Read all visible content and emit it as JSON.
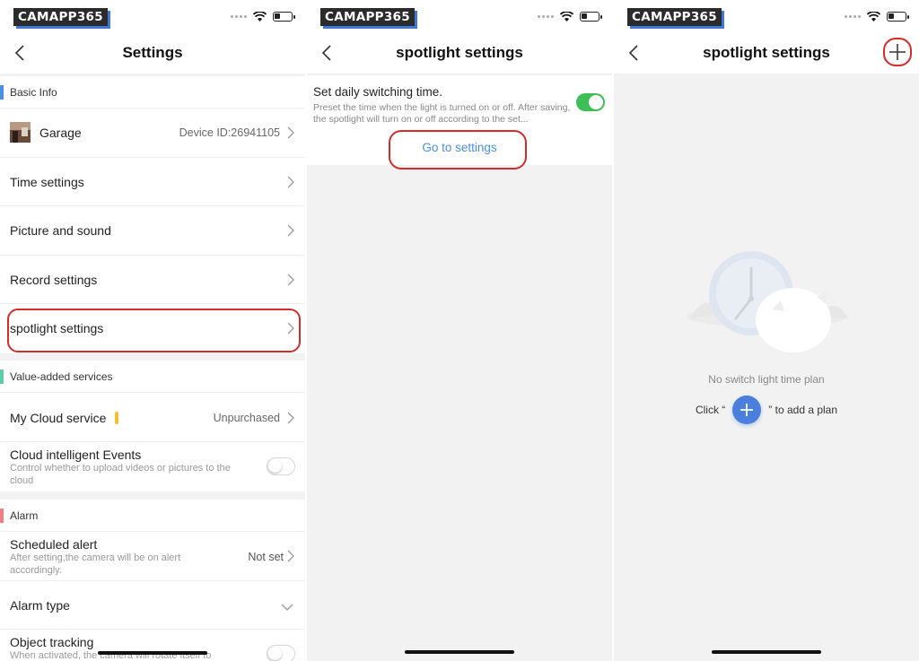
{
  "brand": "CAMAPP365",
  "colors": {
    "accent_blue": "#4a90e2",
    "red_annotation": "#d42b2b",
    "toggle_on": "#3dbe57"
  },
  "panel1": {
    "title": "Settings",
    "basic_info": "Basic Info",
    "device": {
      "name": "Garage",
      "id_label": "Device ID:26941105"
    },
    "rows": [
      "Time settings",
      "Picture and sound",
      "Record settings",
      "spotlight settings"
    ],
    "value_added": "Value-added services",
    "cloud_service": {
      "label": "My Cloud service",
      "value": "Unpurchased"
    },
    "cloud_events": {
      "label": "Cloud intelligent Events",
      "desc": "Control whether to upload videos or pictures to the cloud"
    },
    "alarm": "Alarm",
    "scheduled_alert": {
      "label": "Scheduled alert",
      "desc": "After setting,the camera will be on alert accordingly.",
      "value": "Not set"
    },
    "alarm_type": "Alarm type",
    "object_tracking": {
      "label": "Object tracking",
      "desc": "When activated, the camera will rotate itself to"
    }
  },
  "panel2": {
    "title": "spotlight settings",
    "daily_title": "Set daily switching time.",
    "daily_desc": "Preset the time when the light is turned on or off. After saving, the spotlight will turn on or off according to the set...",
    "go_settings": "Go to settings"
  },
  "panel3": {
    "title": "spotlight settings",
    "empty_text": "No switch light time plan",
    "click_prefix": "Click “",
    "click_suffix": "” to add a plan"
  }
}
